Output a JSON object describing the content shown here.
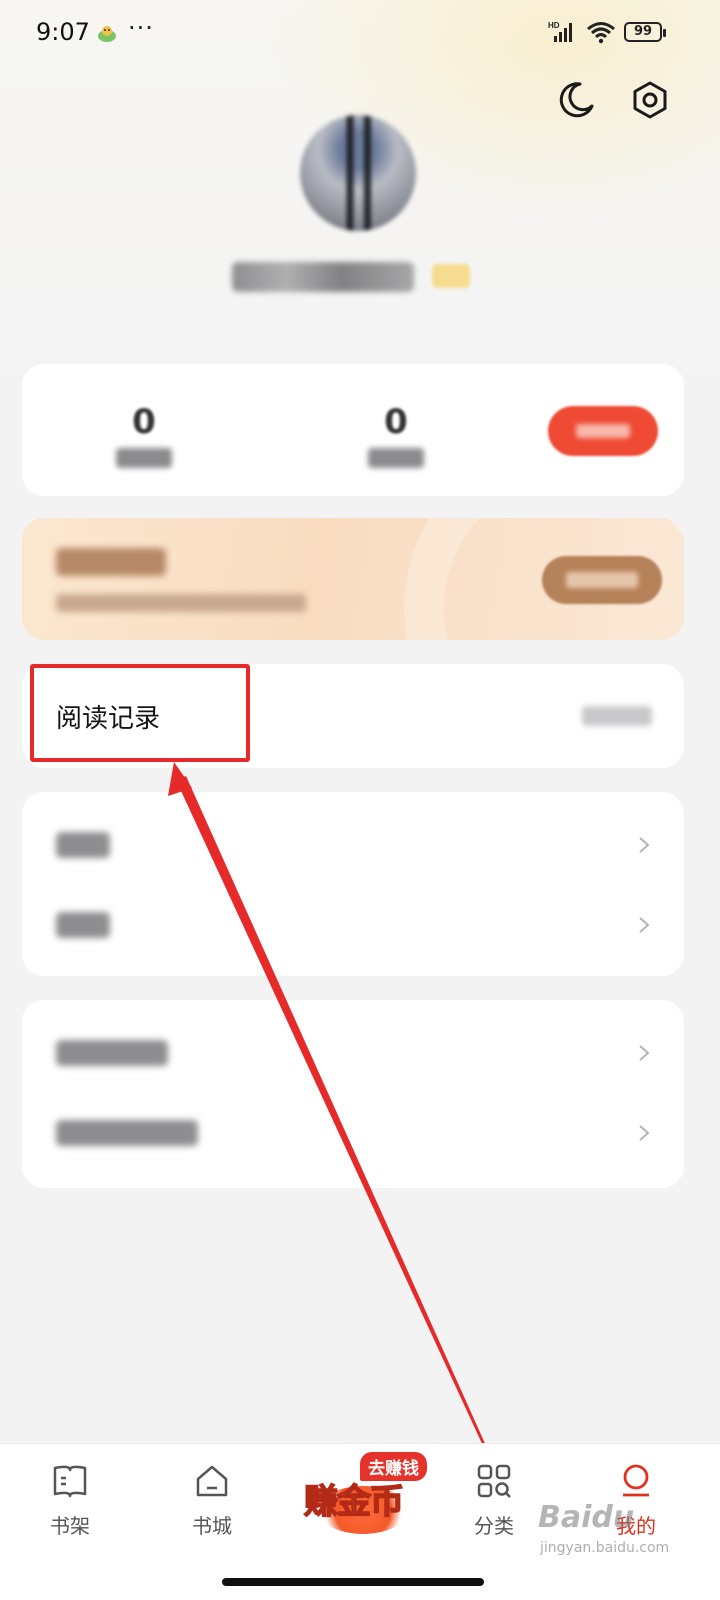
{
  "status_bar": {
    "time": "9:07",
    "dots": "···",
    "battery": "99",
    "icons": [
      "app-notification-icon",
      "signal-icon",
      "wifi-icon",
      "battery-icon"
    ]
  },
  "header": {
    "icons": [
      "night-mode-icon",
      "settings-icon"
    ]
  },
  "profile": {
    "avatar": "avatar",
    "username_blurred": true,
    "vip_badge": true
  },
  "stats": {
    "item1_value": "0",
    "item2_value": "0"
  },
  "reading_record": {
    "label": "阅读记录"
  },
  "tabbar": {
    "tabs": [
      {
        "label": "书架",
        "icon": "bookshelf-icon"
      },
      {
        "label": "书城",
        "icon": "bookstore-home-icon"
      },
      {
        "label": "分类",
        "icon": "category-icon"
      },
      {
        "label": "我的",
        "icon": "profile-icon"
      }
    ],
    "earn_tag": "去赚钱",
    "earn_label": "赚金币"
  },
  "watermark": {
    "brand": "Baidu",
    "site": "jingyan.baidu.com"
  },
  "colors": {
    "highlight": "#e62a2a",
    "active_tab": "#e0331f",
    "background": "#f3f3f4"
  }
}
